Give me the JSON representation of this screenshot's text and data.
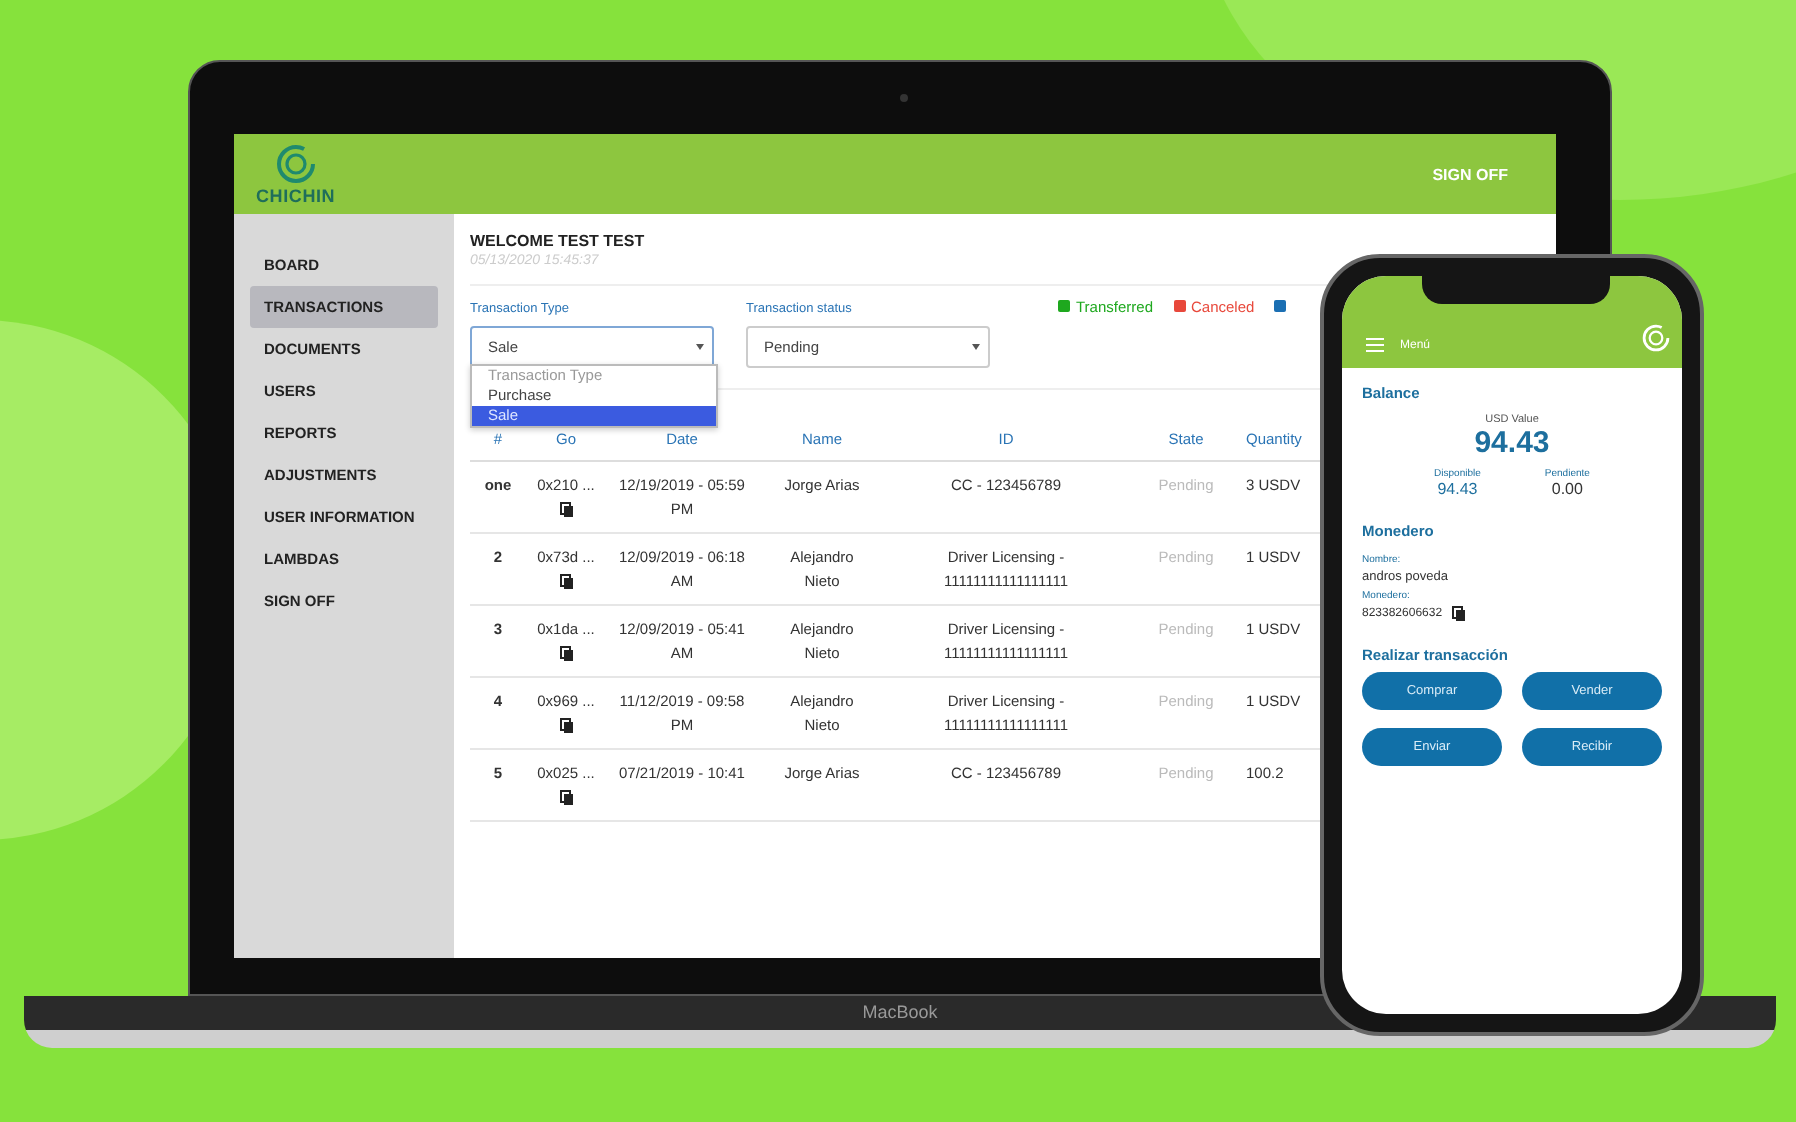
{
  "laptop": {
    "brand": "MacBook",
    "header": {
      "logo": "CHICHIN",
      "action": "SIGN OFF"
    },
    "sidebar": {
      "items": [
        {
          "label": "BOARD",
          "selected": false
        },
        {
          "label": "TRANSACTIONS",
          "selected": true
        },
        {
          "label": "DOCUMENTS",
          "selected": false
        },
        {
          "label": "USERS",
          "selected": false
        },
        {
          "label": "REPORTS",
          "selected": false
        },
        {
          "label": "ADJUSTMENTS",
          "selected": false
        },
        {
          "label": "USER INFORMATION",
          "selected": false
        },
        {
          "label": "LAMBDAS",
          "selected": false
        },
        {
          "label": "SIGN OFF",
          "selected": false
        }
      ]
    },
    "welcome": {
      "title": "WELCOME TEST TEST",
      "timestamp": "05/13/2020 15:45:37"
    },
    "filters": [
      {
        "label": "Transaction Type",
        "value": "Sale",
        "expanded": true,
        "options": [
          {
            "label": "Transaction Type",
            "selected": false,
            "disabled": true
          },
          {
            "label": "Purchase",
            "selected": false,
            "disabled": false
          },
          {
            "label": "Sale",
            "selected": true,
            "disabled": false
          }
        ]
      },
      {
        "label": "Transaction status",
        "value": "Pending",
        "expanded": false
      }
    ],
    "legend": [
      {
        "label": "Transferred",
        "color": "#1ea81e"
      },
      {
        "label": "Canceled",
        "color": "#e8483b"
      },
      {
        "color": "#1b6fb3"
      }
    ],
    "table": {
      "columns": [
        "#",
        "Go",
        "Date",
        "Name",
        "ID",
        "State",
        "Quantity"
      ],
      "rows": [
        {
          "cells": [
            "one",
            "0x210 ...",
            "12/19/2019 - 05:59 PM",
            "Jorge Arias",
            "CC - 123456789",
            "Pending",
            "3 USDV"
          ]
        },
        {
          "cells": [
            "2",
            "0x73d ...",
            "12/09/2019 - 06:18 AM",
            "Alejandro Nieto",
            "Driver Licensing - 11111111111111111",
            "Pending",
            "1 USDV"
          ]
        },
        {
          "cells": [
            "3",
            "0x1da ...",
            "12/09/2019 - 05:41 AM",
            "Alejandro Nieto",
            "Driver Licensing - 11111111111111111",
            "Pending",
            "1 USDV"
          ]
        },
        {
          "cells": [
            "4",
            "0x969 ...",
            "11/12/2019 - 09:58 PM",
            "Alejandro Nieto",
            "Driver Licensing - 11111111111111111",
            "Pending",
            "1 USDV"
          ]
        },
        {
          "cells": [
            "5",
            "0x025 ...",
            "07/21/2019 - 10:41",
            "Jorge Arias",
            "CC - 123456789",
            "Pending",
            "100.2"
          ]
        }
      ]
    }
  },
  "phone": {
    "menu": "Menú",
    "balance": {
      "title": "Balance",
      "usd_label": "USD Value",
      "usd_value": "94.43",
      "available_label": "Disponible",
      "available": "94.43",
      "pending_label": "Pendiente",
      "pending": "0.00"
    },
    "wallet": {
      "title": "Monedero",
      "name_label": "Nombre:",
      "name": "andros poveda",
      "address_label": "Monedero:",
      "address": "823382606632"
    },
    "transact": {
      "title": "Realizar transacción",
      "buttons": [
        "Comprar",
        "Vender",
        "Enviar",
        "Recibir"
      ]
    }
  }
}
